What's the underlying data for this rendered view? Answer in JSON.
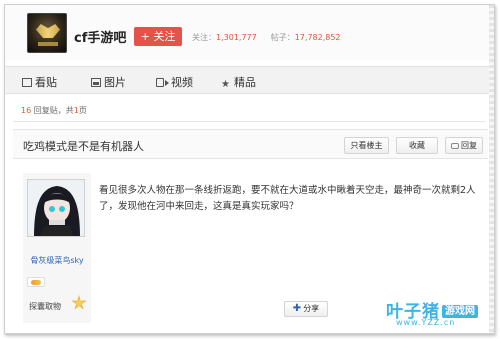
{
  "forum": {
    "name": "cf手游吧",
    "follow_label": "+ 关注",
    "followers_label": "关注：",
    "followers": "1,301,777",
    "posts_label": "帖子：",
    "posts": "17,782,852"
  },
  "tabs": [
    {
      "label": "看贴",
      "icon": "list-icon"
    },
    {
      "label": "图片",
      "icon": "image-icon"
    },
    {
      "label": "视频",
      "icon": "video-icon"
    },
    {
      "label": "精品",
      "icon": "star-icon"
    }
  ],
  "pager": {
    "replies": "16",
    "replies_suffix": " 回复贴，共",
    "pages": "1",
    "pages_suffix": "页"
  },
  "thread": {
    "title": "吃鸡模式是不是有机器人",
    "only_op_label": "只看楼主",
    "favorite_label": "收藏",
    "reply_label": "回复"
  },
  "post": {
    "author": "骨灰级菜鸟sky",
    "honor_label": "探囊取物",
    "content": "看见很多次人物在那一条线折返跑，要不就在大道或水中瞅着天空走，最神奇一次就剩2人了，发现他在河中来回走，这真是真实玩家吗？",
    "share_label": "分享"
  },
  "watermark": {
    "brand": "叶子猪",
    "tag": "游戏网",
    "url": "www.YZZ.cn"
  },
  "colors": {
    "accent_red": "#e4534a",
    "link_blue": "#2d64b3",
    "number_orange": "#e0563a",
    "watermark_blue": "#3fb3e6"
  }
}
